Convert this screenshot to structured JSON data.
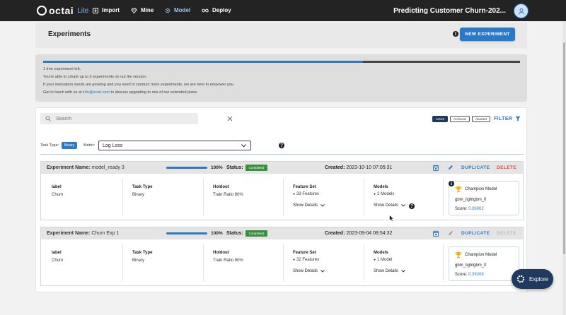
{
  "app": {
    "logo_text": "octai",
    "edition": "Lite",
    "project_title": "Predicting Customer Churn-202..."
  },
  "nav": [
    {
      "label": "Import",
      "icon": "import-icon"
    },
    {
      "label": "Mine",
      "icon": "diamond-icon"
    },
    {
      "label": "Model",
      "icon": "model-gear-icon",
      "active": true
    },
    {
      "label": "Deploy",
      "icon": "infinity-icon"
    }
  ],
  "page": {
    "title": "Experiments",
    "new_experiment_label": "NEW EXPERIMENT"
  },
  "notice": {
    "usage_fraction": 0.67,
    "line1": "1 free experiment left.",
    "line2": "You're able to create up to 3 experiments on our lite version.",
    "line3": "If your innovation needs are growing and you need to conduct more experiments, we are here to empower you.",
    "line4_pre": "Get in touch with us at ",
    "line4_link": "info@octai.com",
    "line4_post": " to discuss upgrading to one of our extended plans."
  },
  "toolbar": {
    "search_placeholder": "Search",
    "filters": [
      "Active",
      "Archived",
      "Aborted"
    ],
    "filter_label": "FILTER",
    "task_type_label": "Task Type:",
    "task_type_value": "Binary",
    "metric_label": "Metric:",
    "metric_value": "Log Loss"
  },
  "experiments": [
    {
      "name_label": "Experiment Name:",
      "name": "model_ready 3",
      "progress": 100,
      "progress_text": "100%",
      "status_label": "Status:",
      "status": "Completed",
      "created_label": "Created:",
      "created": "2023-10-10 07:05:31",
      "duplicate_label": "DUPLICATE",
      "delete_label": "DELETE",
      "delete_enabled": true,
      "label_header": "label",
      "label_value": "Churn",
      "task_header": "Task Type",
      "task_value": "Binary",
      "holdout_header": "Holdout",
      "holdout_value": "Train Ratio 80%",
      "featureset_header": "Feature Set",
      "featureset_value": "33 Features",
      "models_header": "Models",
      "models_value": "2 Models",
      "show_details": "Show Details",
      "champion_title": "Champion Model",
      "champion_model": "gbm_lightgbm_0",
      "score_label": "Score:",
      "score_value": "0.36002"
    },
    {
      "name_label": "Experiment Name:",
      "name": "Churn Exp 1",
      "progress": 100,
      "progress_text": "100%",
      "status_label": "Status:",
      "status": "Completed",
      "created_label": "Created:",
      "created": "2023-09-04 08:54:32",
      "duplicate_label": "DUPLICATE",
      "delete_label": "DELETE",
      "delete_enabled": false,
      "label_header": "label",
      "label_value": "Churn",
      "task_header": "Task Type",
      "task_value": "Binary",
      "holdout_header": "Holdout",
      "holdout_value": "Train Ratio 90%",
      "featureset_header": "Feature Set",
      "featureset_value": "32 Features",
      "models_header": "Models",
      "models_value": "1 Model",
      "show_details": "Show Details",
      "champion_title": "Champion Model",
      "champion_model": "gbm_lightgbm_0",
      "score_label": "Score:",
      "score_value": "0.39208"
    }
  ],
  "explore": {
    "label": "Explore"
  },
  "colors": {
    "accent": "#2a78c8",
    "navbar": "#232323",
    "success": "#3a8f3e",
    "danger": "#e04848",
    "explore": "#1f3a5c"
  }
}
